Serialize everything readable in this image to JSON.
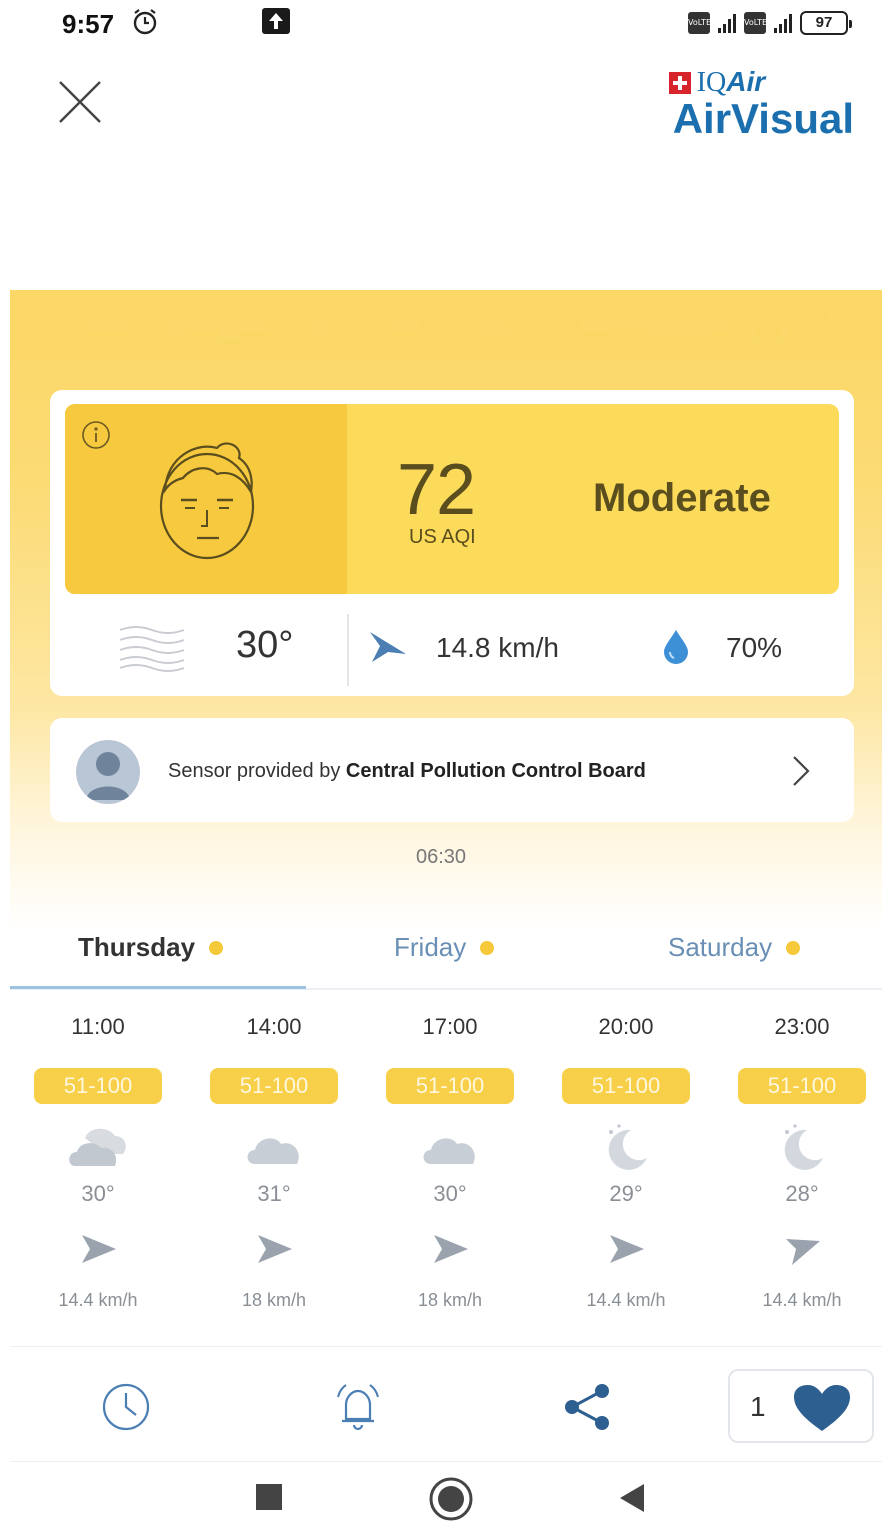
{
  "status_bar": {
    "time": "9:57",
    "battery": "97"
  },
  "brand": {
    "company_prefix": "IQ",
    "company_suffix": "Air",
    "app_name": "AirVisual",
    "color": "#1c6fae"
  },
  "aqi": {
    "value": "72",
    "unit": "US AQI",
    "level": "Moderate",
    "level_color": "#f7c93e"
  },
  "current_weather": {
    "temperature": "30°",
    "wind": "14.8 km/h",
    "humidity": "70%"
  },
  "sensor": {
    "prefix": "Sensor provided by ",
    "provider": "Central Pollution Control Board"
  },
  "updated_time": "06:30",
  "day_tabs": [
    {
      "label": "Thursday",
      "active": true
    },
    {
      "label": "Friday",
      "active": false
    },
    {
      "label": "Saturday",
      "active": false
    }
  ],
  "hourly": [
    {
      "time": "11:00",
      "aqi_range": "51-100",
      "icon": "partly-cloudy-icon",
      "temp": "30°",
      "wind": "14.4 km/h"
    },
    {
      "time": "14:00",
      "aqi_range": "51-100",
      "icon": "cloud-icon",
      "temp": "31°",
      "wind": "18 km/h"
    },
    {
      "time": "17:00",
      "aqi_range": "51-100",
      "icon": "cloud-icon",
      "temp": "30°",
      "wind": "18 km/h"
    },
    {
      "time": "20:00",
      "aqi_range": "51-100",
      "icon": "moon-icon",
      "temp": "29°",
      "wind": "14.4 km/h"
    },
    {
      "time": "23:00",
      "aqi_range": "51-100",
      "icon": "moon-icon",
      "temp": "28°",
      "wind": "14.4 km/h"
    }
  ],
  "actions": {
    "favorite_count": "1"
  }
}
